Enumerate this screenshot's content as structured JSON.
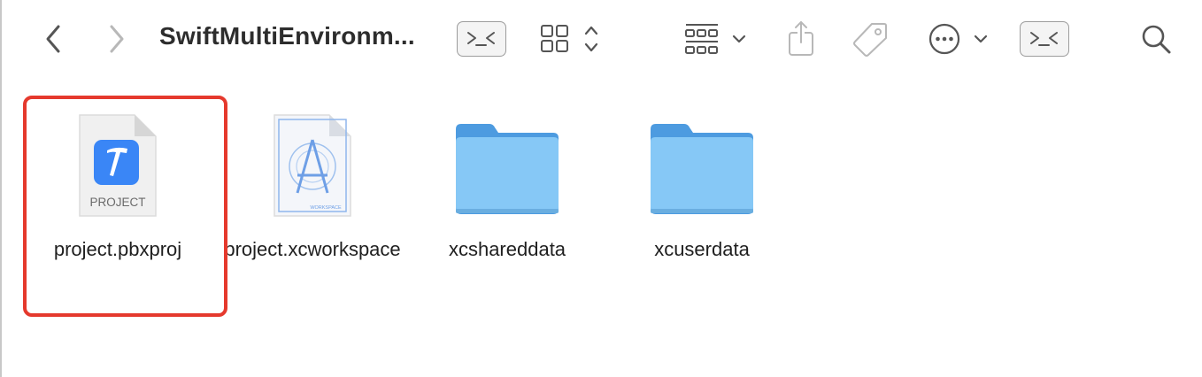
{
  "toolbar": {
    "title": "SwiftMultiEnvironm..."
  },
  "files": [
    {
      "name": "project.pbxproj",
      "kind": "project-file",
      "badge": "PROJECT"
    },
    {
      "name": "project.xcworkspace",
      "kind": "workspace-file",
      "badge": "WORKSPACE"
    },
    {
      "name": "xcshareddata",
      "kind": "folder"
    },
    {
      "name": "xcuserdata",
      "kind": "folder"
    }
  ],
  "colors": {
    "highlight": "#e5392d",
    "folder": "#7ec4f2",
    "xcode_blue": "#3a86f6"
  }
}
